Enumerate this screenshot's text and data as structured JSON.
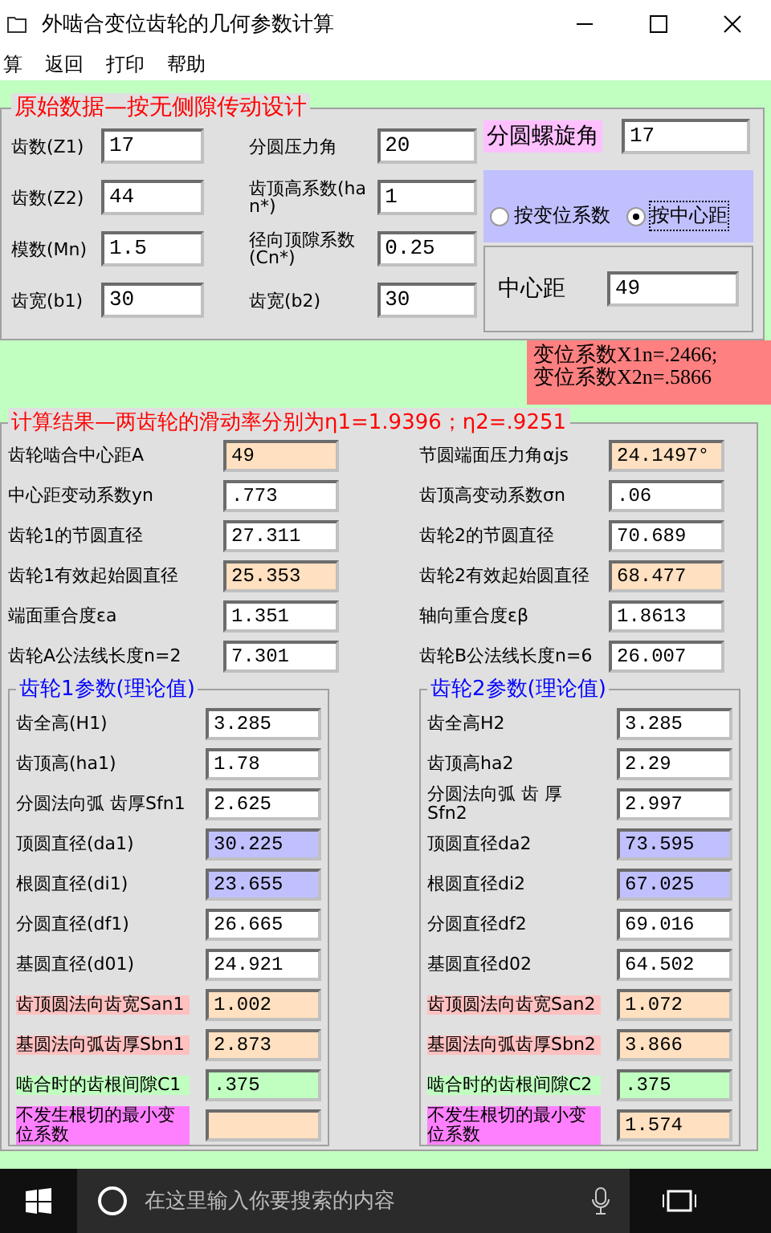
{
  "window": {
    "title": "外啮合变位齿轮的几何参数计算"
  },
  "menu": [
    "算",
    "返回",
    "打印",
    "帮助"
  ],
  "input_group": {
    "title": "原始数据—按无侧隙传动设计",
    "fields": [
      {
        "label": "齿数(Z1)",
        "value": "17"
      },
      {
        "label": "分圆压力角",
        "value": "20"
      },
      {
        "label": "齿数(Z2)",
        "value": "44"
      },
      {
        "label": "齿顶高系数(han*)",
        "value": "1"
      },
      {
        "label": "模数(Mn)",
        "value": "1.5"
      },
      {
        "label": "径向顶隙系数(Cn*)",
        "value": "0.25"
      },
      {
        "label": "齿宽(b1)",
        "value": "30"
      },
      {
        "label": "齿宽(b2)",
        "value": "30"
      }
    ],
    "helix": {
      "label": "分圆螺旋角",
      "value": "17"
    },
    "mode_options": [
      {
        "label": "按变位系数",
        "selected": false
      },
      {
        "label": "按中心距",
        "selected": true
      }
    ],
    "center_distance": {
      "label": "中心距",
      "value": "49"
    }
  },
  "shift_result": [
    "变位系数X1n=.2466;",
    "变位系数X2n=.5866"
  ],
  "results_group": {
    "title": "计算结果—两齿轮的滑动率分别为η1=1.9396；η2=.9251",
    "rows": [
      {
        "label": "齿轮啮合中心距A",
        "value": "49",
        "color": "#ffe0c0"
      },
      {
        "label": "节圆端面压力角αjs",
        "value": "24.1497°",
        "color": "#ffe0c0"
      },
      {
        "label": "中心距变动系数yn",
        "value": ".773",
        "color": "#ffffff"
      },
      {
        "label": "齿顶高变动系数σn",
        "value": ".06",
        "color": "#ffffff"
      },
      {
        "label": "齿轮1的节圆直径",
        "value": "27.311",
        "color": "#ffffff"
      },
      {
        "label": "齿轮2的节圆直径",
        "value": "70.689",
        "color": "#ffffff"
      },
      {
        "label": "齿轮1有效起始圆直径",
        "value": "25.353",
        "color": "#ffe0c0"
      },
      {
        "label": "齿轮2有效起始圆直径",
        "value": "68.477",
        "color": "#ffe0c0"
      },
      {
        "label": "端面重合度εa",
        "value": "1.351",
        "color": "#ffffff"
      },
      {
        "label": "轴向重合度εβ",
        "value": "1.8613",
        "color": "#ffffff"
      },
      {
        "label": "齿轮A公法线长度n=2",
        "value": "7.301",
        "color": "#ffffff"
      },
      {
        "label": "齿轮B公法线长度n=6",
        "value": "26.007",
        "color": "#ffffff"
      }
    ]
  },
  "gear_groups": [
    {
      "title": "齿轮1参数(理论值)",
      "rows": [
        {
          "label": "齿全高(H1)",
          "value": "3.285",
          "color": "#ffffff"
        },
        {
          "label": "齿顶高(ha1)",
          "value": "1.78",
          "color": "#ffffff"
        },
        {
          "label": "分圆法向弧 齿厚Sfn1",
          "value": "2.625",
          "color": "#ffffff"
        },
        {
          "label": "顶圆直径(da1)",
          "value": "30.225",
          "color": "#c0c0ff"
        },
        {
          "label": "根圆直径(di1)",
          "value": "23.655",
          "color": "#c0c0ff"
        },
        {
          "label": "分圆直径(df1)",
          "value": "26.665",
          "color": "#ffffff"
        },
        {
          "label": "基圆直径(d01)",
          "value": "24.921",
          "color": "#ffffff"
        },
        {
          "label": "齿顶圆法向齿宽San1",
          "value": "1.002",
          "color": "#ffe0c0",
          "label_fill": {
            "color": "#ffc0c0"
          }
        },
        {
          "label": "基圆法向弧齿厚Sbn1",
          "value": "2.873",
          "color": "#ffe0c0",
          "label_fill": {
            "color": "#ffc0c0"
          }
        },
        {
          "label": "啮合时的齿根间隙C1",
          "value": ".375",
          "color": "#c0ffc0",
          "label_fill": {
            "color": "#c0ffc0"
          }
        },
        {
          "label": "不发生根切的最小变位系数",
          "color": "#ffe0c0",
          "label_fill": {
            "color": "#ff80ff"
          }
        }
      ]
    },
    {
      "title": "齿轮2参数(理论值)",
      "rows": [
        {
          "label": "齿全高H2",
          "value": "3.285",
          "color": "#ffffff"
        },
        {
          "label": "齿顶高ha2",
          "value": "2.29",
          "color": "#ffffff"
        },
        {
          "label": "分圆法向弧 齿 厚Sfn2",
          "value": "2.997",
          "color": "#ffffff"
        },
        {
          "label": "顶圆直径da2",
          "value": "73.595",
          "color": "#c0c0ff"
        },
        {
          "label": "根圆直径di2",
          "value": "67.025",
          "color": "#c0c0ff"
        },
        {
          "label": "分圆直径df2",
          "value": "69.016",
          "color": "#ffffff"
        },
        {
          "label": "基圆直径d02",
          "value": "64.502",
          "color": "#ffffff"
        },
        {
          "label": "齿顶圆法向齿宽San2",
          "value": "1.072",
          "color": "#ffe0c0",
          "label_fill": {
            "color": "#ffc0c0"
          }
        },
        {
          "label": "基圆法向弧齿厚Sbn2",
          "value": "3.866",
          "color": "#ffe0c0",
          "label_fill": {
            "color": "#ffc0c0"
          }
        },
        {
          "label": "啮合时的齿根间隙C2",
          "value": ".375",
          "color": "#c0ffc0",
          "label_fill": {
            "color": "#c0ffc0"
          }
        },
        {
          "label": "不发生根切的最小变位系数",
          "value": "1.574",
          "color": "#ffe0c0",
          "label_fill": {
            "color": "#ff80ff"
          }
        }
      ]
    }
  ],
  "taskbar": {
    "search_placeholder": "在这里输入你要搜索的内容"
  }
}
